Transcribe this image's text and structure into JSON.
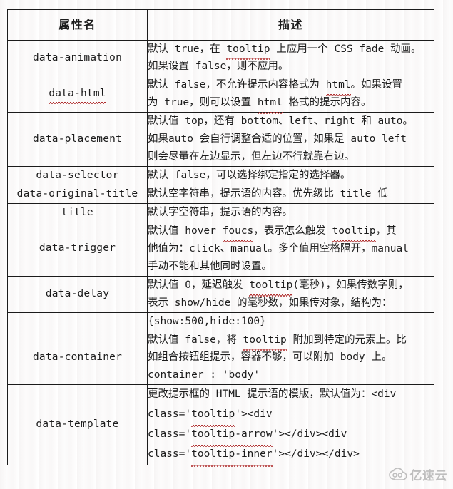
{
  "table": {
    "headers": {
      "name": "属性名",
      "description": "描述"
    },
    "rows": [
      {
        "name": "data-animation",
        "name_squiggle": false,
        "description": "默认 true，在 tooltip 上应用一个 CSS fade 动画。\n如果设置 false，则不应用。",
        "squiggle_words": [
          "tooltip"
        ]
      },
      {
        "name": "data-html",
        "name_squiggle": true,
        "description": "默认 false，不允许提示内容格式为 html。如果设置\n为 true，则可以设置 html 格式的提示内容。",
        "squiggle_words": [
          "html"
        ]
      },
      {
        "name": "data-placement",
        "name_squiggle": false,
        "description": "默认值 top，还有 bottom、left、right 和 auto。\n如果auto 会自行调整合适的位置，如果是 auto left\n则会尽量在左边显示，但左边不行就靠右边。",
        "squiggle_words": []
      },
      {
        "name": "data-selector",
        "name_squiggle": false,
        "description": "默认 false，可以选择绑定指定的选择器。",
        "squiggle_words": []
      },
      {
        "name": "data-original-title",
        "name_squiggle": false,
        "description": "默认空字符串，提示语的内容。优先级比 title 低",
        "squiggle_words": []
      },
      {
        "name": "title",
        "name_squiggle": false,
        "description": "默认字空符串，提示语的内容。",
        "squiggle_words": []
      },
      {
        "name": "data-trigger",
        "name_squiggle": false,
        "description": "默认值 hover foucs，表示怎么触发 tooltip，其\n他值为：click、manual。多个值用空格隔开，manual\n手动不能和其他同时设置。",
        "squiggle_words": [
          "foucs",
          "tooltip"
        ]
      },
      {
        "name": "data-delay",
        "name_squiggle": false,
        "description": "默认值 0，延迟触发 tooltip(毫秒)，如果传数字则，\n表示 show/hide 的毫秒数，如果传对象，结构为：",
        "squiggle_words": [
          "tooltip"
        ]
      },
      {
        "name": "",
        "name_squiggle": false,
        "description": "{show:500,hide:100}",
        "squiggle_words": []
      },
      {
        "name": "data-container",
        "name_squiggle": false,
        "description": "默认值 false，将 tooltip 附加到特定的元素上。比\n如组合按钮组提示，容器不够，可以附加 body 上。\ncontainer : 'body'",
        "squiggle_words": [
          "tooltip"
        ]
      },
      {
        "name": "data-template",
        "name_squiggle": false,
        "description": "更改提示框的 HTML 提示语的模版，默认值为：<div\nclass='tooltip'><div\nclass='tooltip-arrow'></div><div\nclass='tooltip-inner'></div></div>",
        "squiggle_words": [
          "tooltip",
          "tooltip-arrow",
          "tooltip-inner"
        ]
      }
    ]
  },
  "watermark": {
    "text": "亿速云",
    "icon": "cloud-logo-icon",
    "color": "#9b9b9b"
  },
  "colors": {
    "border": "#1b1b1b",
    "text": "#1c1c1c",
    "spellcheck_underline": "#b03030",
    "background": "#ffffff"
  }
}
